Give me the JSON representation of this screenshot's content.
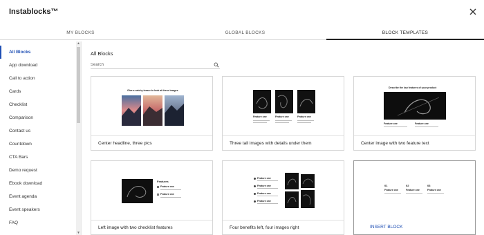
{
  "app": {
    "title": "Instablocks™"
  },
  "tabs": [
    {
      "label": "MY BLOCKS"
    },
    {
      "label": "GLOBAL BLOCKS"
    },
    {
      "label": "BLOCK TEMPLATES"
    }
  ],
  "sidebar": {
    "items": [
      {
        "label": "All Blocks"
      },
      {
        "label": "App download"
      },
      {
        "label": "Call to action"
      },
      {
        "label": "Cards"
      },
      {
        "label": "Checklist"
      },
      {
        "label": "Comparison"
      },
      {
        "label": "Contact us"
      },
      {
        "label": "Countdown"
      },
      {
        "label": "CTA Bars"
      },
      {
        "label": "Demo request"
      },
      {
        "label": "Ebook download"
      },
      {
        "label": "Event agenda"
      },
      {
        "label": "Event speakers"
      },
      {
        "label": "FAQ"
      }
    ]
  },
  "main": {
    "title": "All Blocks",
    "search": {
      "placeholder": "Search",
      "value": ""
    },
    "cards": [
      {
        "label": "Center headline, three pics",
        "preview": {
          "headline": "Give a catchy teaser to look at these images"
        }
      },
      {
        "label": "Three tall images with details under them",
        "preview": {
          "feature_label": "Feature one"
        }
      },
      {
        "label": "Center image with two feature text",
        "preview": {
          "headline": "Describe the key features of your product",
          "feature_label": "Feature one"
        }
      },
      {
        "label": "Left image with two checklist features",
        "preview": {
          "heading": "Features",
          "item_label": "Feature one"
        }
      },
      {
        "label": "Four benefits left, four images right",
        "preview": {
          "item_label": "Feature one"
        }
      },
      {
        "label": "INSERT BLOCK",
        "preview": {
          "numbers": [
            "01",
            "02",
            "03"
          ],
          "feature_label": "Feature one"
        }
      }
    ]
  },
  "icons": {
    "close": "close-icon",
    "search": "search-icon",
    "scroll_up": "chevron-up-icon",
    "scroll_down": "chevron-down-icon"
  },
  "colors": {
    "accent": "#1f4fb4",
    "text": "#222222",
    "border": "#d6d6d6"
  }
}
